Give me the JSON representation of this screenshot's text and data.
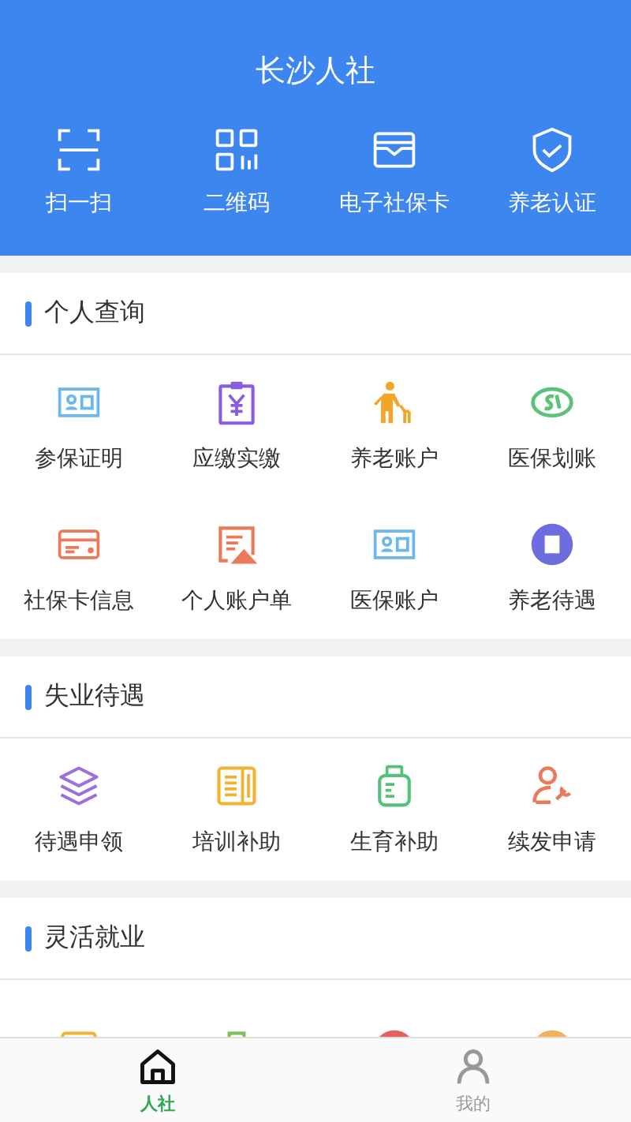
{
  "header": {
    "title": "长沙人社"
  },
  "quick_actions": [
    {
      "label": "扫一扫"
    },
    {
      "label": "二维码"
    },
    {
      "label": "电子社保卡"
    },
    {
      "label": "养老认证"
    }
  ],
  "sections": [
    {
      "title": "个人查询",
      "items": [
        {
          "label": "参保证明"
        },
        {
          "label": "应缴实缴"
        },
        {
          "label": "养老账户"
        },
        {
          "label": "医保划账"
        },
        {
          "label": "社保卡信息"
        },
        {
          "label": "个人账户单"
        },
        {
          "label": "医保账户"
        },
        {
          "label": "养老待遇"
        }
      ]
    },
    {
      "title": "失业待遇",
      "items": [
        {
          "label": "待遇申领"
        },
        {
          "label": "培训补助"
        },
        {
          "label": "生育补助"
        },
        {
          "label": "续发申请"
        }
      ]
    },
    {
      "title": "灵活就业"
    }
  ],
  "tab_bar": [
    {
      "label": "人社",
      "selected": true
    },
    {
      "label": "我的",
      "selected": false
    }
  ]
}
